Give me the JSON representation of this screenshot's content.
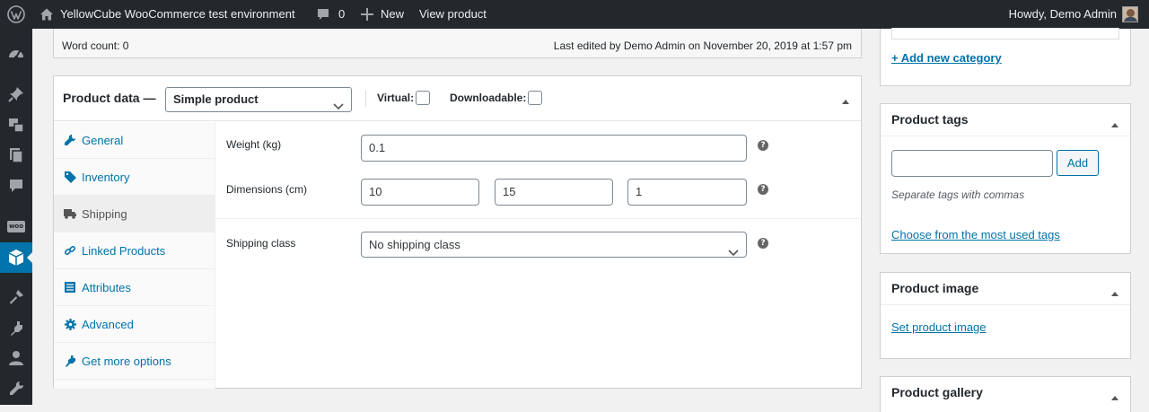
{
  "admin_bar": {
    "site_name": "YellowCube WooCommerce test environment",
    "comments_count": "0",
    "new_label": "New",
    "view_product_label": "View product",
    "greeting": "Howdy, Demo Admin"
  },
  "side_menu": {
    "icons": [
      "dashboard-icon",
      "pin-icon",
      "media-icon",
      "pages-icon",
      "comments-icon",
      "woocommerce-icon",
      "products-icon",
      "appearance-icon",
      "plugins-icon",
      "users-icon",
      "tools-icon"
    ],
    "woo_badge": "woo",
    "current": "products-icon"
  },
  "editor_footer": {
    "word_count": "Word count: 0",
    "last_edited": "Last edited by Demo Admin on November 20, 2019 at 1:57 pm"
  },
  "product_data": {
    "title": "Product data —",
    "type_selected": "Simple product",
    "virtual_label": "Virtual:",
    "downloadable_label": "Downloadable:",
    "tabs": [
      {
        "label": "General",
        "icon": "wrench-icon"
      },
      {
        "label": "Inventory",
        "icon": "tag-icon"
      },
      {
        "label": "Shipping",
        "icon": "truck-icon"
      },
      {
        "label": "Linked Products",
        "icon": "link-icon"
      },
      {
        "label": "Attributes",
        "icon": "list-icon"
      },
      {
        "label": "Advanced",
        "icon": "gear-icon"
      },
      {
        "label": "Get more options",
        "icon": "plugin-icon"
      }
    ],
    "active_tab": "Shipping",
    "shipping": {
      "weight_label": "Weight (kg)",
      "weight_value": "0.1",
      "dimensions_label": "Dimensions (cm)",
      "length": "10",
      "width": "15",
      "height": "1",
      "class_label": "Shipping class",
      "class_selected": "No shipping class"
    },
    "help_glyph": "?"
  },
  "sidebar": {
    "categories": {
      "add_new_link": "+ Add new category"
    },
    "tags": {
      "title": "Product tags",
      "add_button": "Add",
      "hint": "Separate tags with commas",
      "choose_link": "Choose from the most used tags"
    },
    "image": {
      "title": "Product image",
      "set_link": "Set product image"
    },
    "gallery": {
      "title": "Product gallery"
    }
  },
  "colors": {
    "admin_bar": "#23282d",
    "accent": "#0073aa",
    "background": "#f1f1f1"
  }
}
